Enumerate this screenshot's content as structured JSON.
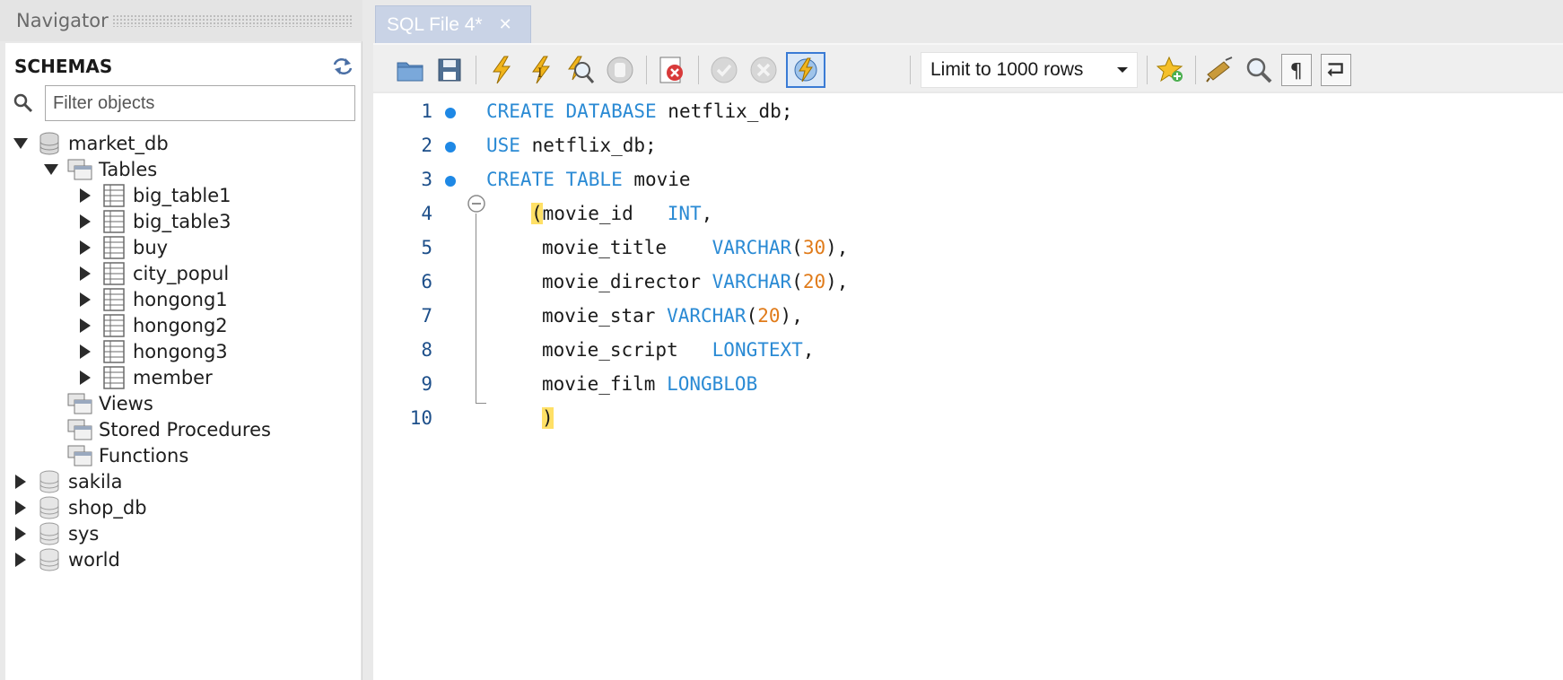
{
  "navigator": {
    "title": "Navigator",
    "schemas_label": "SCHEMAS",
    "filter_placeholder": "Filter objects",
    "tree": [
      {
        "label": "market_db",
        "type": "database",
        "expanded": true,
        "level": 0
      },
      {
        "label": "Tables",
        "type": "folder",
        "expanded": true,
        "level": 1
      },
      {
        "label": "big_table1",
        "type": "table",
        "level": 2
      },
      {
        "label": "big_table3",
        "type": "table",
        "level": 2
      },
      {
        "label": "buy",
        "type": "table",
        "level": 2
      },
      {
        "label": "city_popul",
        "type": "table",
        "level": 2
      },
      {
        "label": "hongong1",
        "type": "table",
        "level": 2
      },
      {
        "label": "hongong2",
        "type": "table",
        "level": 2
      },
      {
        "label": "hongong3",
        "type": "table",
        "level": 2
      },
      {
        "label": "member",
        "type": "table",
        "level": 2
      },
      {
        "label": "Views",
        "type": "folder",
        "level": 1
      },
      {
        "label": "Stored Procedures",
        "type": "folder",
        "level": 1
      },
      {
        "label": "Functions",
        "type": "folder",
        "level": 1
      },
      {
        "label": "sakila",
        "type": "database",
        "expanded": false,
        "level": 0
      },
      {
        "label": "shop_db",
        "type": "database",
        "expanded": false,
        "level": 0
      },
      {
        "label": "sys",
        "type": "database",
        "expanded": false,
        "level": 0
      },
      {
        "label": "world",
        "type": "database",
        "expanded": false,
        "level": 0
      }
    ]
  },
  "editor": {
    "tab_label": "SQL File 4*",
    "limit_option": "Limit to 1000 rows",
    "toolbar_icons": [
      "open-file-icon",
      "save-icon",
      "execute-icon",
      "execute-current-icon",
      "explain-icon",
      "stop-icon",
      "toggle-error-icon",
      "commit-icon",
      "rollback-icon",
      "autocommit-icon",
      "bookmark-icon",
      "beautify-icon",
      "find-icon",
      "invisible-chars-icon",
      "word-wrap-icon"
    ],
    "lines": [
      {
        "num": "1",
        "text": "CREATE DATABASE netflix_db;"
      },
      {
        "num": "2",
        "text": "USE netflix_db;"
      },
      {
        "num": "3",
        "text": "CREATE TABLE movie"
      },
      {
        "num": "4",
        "text": "(movie_id   INT,"
      },
      {
        "num": "5",
        "text": "movie_title    VARCHAR(30),"
      },
      {
        "num": "6",
        "text": "movie_director VARCHAR(20),"
      },
      {
        "num": "7",
        "text": "movie_star VARCHAR(20),"
      },
      {
        "num": "8",
        "text": "movie_script   LONGTEXT,"
      },
      {
        "num": "9",
        "text": "movie_film LONGBLOB"
      },
      {
        "num": "10",
        "text": ")"
      }
    ]
  },
  "colors": {
    "keyword": "#2a8ad4",
    "number": "#e07b1a",
    "line_number": "#1d4f8a",
    "statement_dot": "#1e88e5",
    "bracket_highlight": "#ffe066",
    "tab_background": "#c9d3e6"
  }
}
